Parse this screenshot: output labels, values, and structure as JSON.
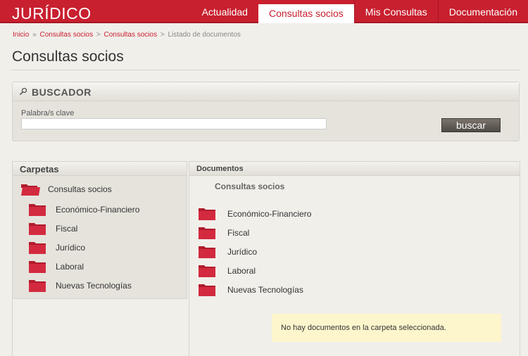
{
  "header": {
    "brand": "JURÍDICO",
    "nav": [
      {
        "label": "Actualidad",
        "active": false
      },
      {
        "label": "Consultas socios",
        "active": true
      },
      {
        "label": "Mis Consultas",
        "active": false
      },
      {
        "label": "Documentación",
        "active": false
      }
    ]
  },
  "breadcrumb": {
    "items": [
      "Inicio",
      "Consultas socios",
      "Consultas socios"
    ],
    "separator": "»",
    "separator2": ">",
    "current": "Listado de documentos"
  },
  "page": {
    "title": "Consultas socios"
  },
  "search": {
    "heading": "BUSCADOR",
    "keyword_label": "Palabra/s clave",
    "keyword_value": "",
    "button_label": "buscar"
  },
  "folders": {
    "heading": "Carpetas",
    "root": "Consultas socios",
    "items": [
      "Económico-Financiero",
      "Fiscal",
      "Jurídico",
      "Laboral",
      "Nuevas Tecnologías"
    ]
  },
  "documents": {
    "heading": "Documentos",
    "folder_title": "Consultas socios",
    "items": [
      "Económico-Financiero",
      "Fiscal",
      "Jurídico",
      "Laboral",
      "Nuevas Tecnologías"
    ],
    "empty_notice": "No hay documentos en la carpeta seleccionada."
  },
  "colors": {
    "brand": "#c8202f",
    "folder": "#d32a3f",
    "notice": "#fdf6cc"
  }
}
